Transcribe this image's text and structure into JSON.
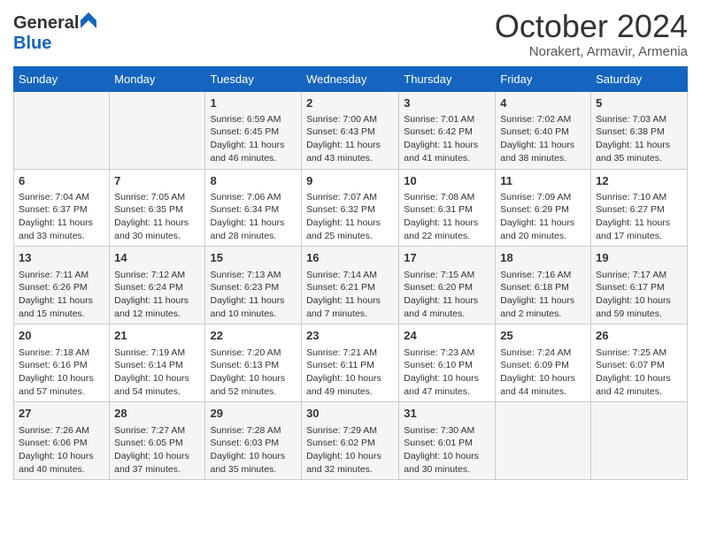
{
  "header": {
    "logo": {
      "general": "General",
      "blue": "Blue"
    },
    "title": "October 2024",
    "subtitle": "Norakert, Armavir, Armenia"
  },
  "weekdays": [
    "Sunday",
    "Monday",
    "Tuesday",
    "Wednesday",
    "Thursday",
    "Friday",
    "Saturday"
  ],
  "weeks": [
    [
      {
        "day": null,
        "info": null
      },
      {
        "day": null,
        "info": null
      },
      {
        "day": "1",
        "info": "Sunrise: 6:59 AM\nSunset: 6:45 PM\nDaylight: 11 hours and 46 minutes."
      },
      {
        "day": "2",
        "info": "Sunrise: 7:00 AM\nSunset: 6:43 PM\nDaylight: 11 hours and 43 minutes."
      },
      {
        "day": "3",
        "info": "Sunrise: 7:01 AM\nSunset: 6:42 PM\nDaylight: 11 hours and 41 minutes."
      },
      {
        "day": "4",
        "info": "Sunrise: 7:02 AM\nSunset: 6:40 PM\nDaylight: 11 hours and 38 minutes."
      },
      {
        "day": "5",
        "info": "Sunrise: 7:03 AM\nSunset: 6:38 PM\nDaylight: 11 hours and 35 minutes."
      }
    ],
    [
      {
        "day": "6",
        "info": "Sunrise: 7:04 AM\nSunset: 6:37 PM\nDaylight: 11 hours and 33 minutes."
      },
      {
        "day": "7",
        "info": "Sunrise: 7:05 AM\nSunset: 6:35 PM\nDaylight: 11 hours and 30 minutes."
      },
      {
        "day": "8",
        "info": "Sunrise: 7:06 AM\nSunset: 6:34 PM\nDaylight: 11 hours and 28 minutes."
      },
      {
        "day": "9",
        "info": "Sunrise: 7:07 AM\nSunset: 6:32 PM\nDaylight: 11 hours and 25 minutes."
      },
      {
        "day": "10",
        "info": "Sunrise: 7:08 AM\nSunset: 6:31 PM\nDaylight: 11 hours and 22 minutes."
      },
      {
        "day": "11",
        "info": "Sunrise: 7:09 AM\nSunset: 6:29 PM\nDaylight: 11 hours and 20 minutes."
      },
      {
        "day": "12",
        "info": "Sunrise: 7:10 AM\nSunset: 6:27 PM\nDaylight: 11 hours and 17 minutes."
      }
    ],
    [
      {
        "day": "13",
        "info": "Sunrise: 7:11 AM\nSunset: 6:26 PM\nDaylight: 11 hours and 15 minutes."
      },
      {
        "day": "14",
        "info": "Sunrise: 7:12 AM\nSunset: 6:24 PM\nDaylight: 11 hours and 12 minutes."
      },
      {
        "day": "15",
        "info": "Sunrise: 7:13 AM\nSunset: 6:23 PM\nDaylight: 11 hours and 10 minutes."
      },
      {
        "day": "16",
        "info": "Sunrise: 7:14 AM\nSunset: 6:21 PM\nDaylight: 11 hours and 7 minutes."
      },
      {
        "day": "17",
        "info": "Sunrise: 7:15 AM\nSunset: 6:20 PM\nDaylight: 11 hours and 4 minutes."
      },
      {
        "day": "18",
        "info": "Sunrise: 7:16 AM\nSunset: 6:18 PM\nDaylight: 11 hours and 2 minutes."
      },
      {
        "day": "19",
        "info": "Sunrise: 7:17 AM\nSunset: 6:17 PM\nDaylight: 10 hours and 59 minutes."
      }
    ],
    [
      {
        "day": "20",
        "info": "Sunrise: 7:18 AM\nSunset: 6:16 PM\nDaylight: 10 hours and 57 minutes."
      },
      {
        "day": "21",
        "info": "Sunrise: 7:19 AM\nSunset: 6:14 PM\nDaylight: 10 hours and 54 minutes."
      },
      {
        "day": "22",
        "info": "Sunrise: 7:20 AM\nSunset: 6:13 PM\nDaylight: 10 hours and 52 minutes."
      },
      {
        "day": "23",
        "info": "Sunrise: 7:21 AM\nSunset: 6:11 PM\nDaylight: 10 hours and 49 minutes."
      },
      {
        "day": "24",
        "info": "Sunrise: 7:23 AM\nSunset: 6:10 PM\nDaylight: 10 hours and 47 minutes."
      },
      {
        "day": "25",
        "info": "Sunrise: 7:24 AM\nSunset: 6:09 PM\nDaylight: 10 hours and 44 minutes."
      },
      {
        "day": "26",
        "info": "Sunrise: 7:25 AM\nSunset: 6:07 PM\nDaylight: 10 hours and 42 minutes."
      }
    ],
    [
      {
        "day": "27",
        "info": "Sunrise: 7:26 AM\nSunset: 6:06 PM\nDaylight: 10 hours and 40 minutes."
      },
      {
        "day": "28",
        "info": "Sunrise: 7:27 AM\nSunset: 6:05 PM\nDaylight: 10 hours and 37 minutes."
      },
      {
        "day": "29",
        "info": "Sunrise: 7:28 AM\nSunset: 6:03 PM\nDaylight: 10 hours and 35 minutes."
      },
      {
        "day": "30",
        "info": "Sunrise: 7:29 AM\nSunset: 6:02 PM\nDaylight: 10 hours and 32 minutes."
      },
      {
        "day": "31",
        "info": "Sunrise: 7:30 AM\nSunset: 6:01 PM\nDaylight: 10 hours and 30 minutes."
      },
      {
        "day": null,
        "info": null
      },
      {
        "day": null,
        "info": null
      }
    ]
  ]
}
